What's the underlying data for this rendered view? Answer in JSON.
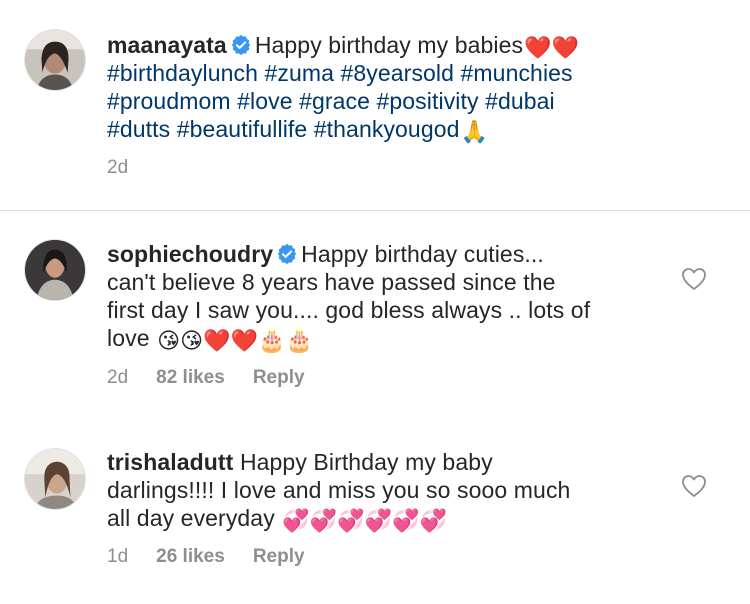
{
  "caption": {
    "username": "maanayata",
    "text": "Happy birthday my babies",
    "emoji_end": "❤️❤️",
    "hashtags_line1": "#birthdaylunch #zuma #8yearsold #munchies",
    "hashtags_line2": "#proudmom #love #grace #positivity #dubai",
    "hashtags_line3": "#dutts #beautifullife #thankyougod",
    "emoji_pray": "🙏",
    "time": "2d"
  },
  "comments": [
    {
      "username": "sophiechoudry",
      "line1": "Happy birthday cuties...",
      "line2": "can't believe 8 years have passed since the",
      "line3": "first day I saw you.... god bless always .. lots of",
      "line4": "love",
      "emojis": "😘😘❤️❤️🎂🎂",
      "time": "2d",
      "likes": "82 likes",
      "reply": "Reply"
    },
    {
      "username": "trishaladutt",
      "line1": "Happy Birthday my baby",
      "line2": "darlings!!!! I love and miss you so sooo much",
      "line3": "all day everyday",
      "emojis": "💞💞💞💞💞💞",
      "time": "1d",
      "likes": "26 likes",
      "reply": "Reply"
    }
  ],
  "colors": {
    "hashtag": "#00376b",
    "verified": "#3897f0",
    "muted": "#8e8e8e",
    "text": "#262626"
  }
}
